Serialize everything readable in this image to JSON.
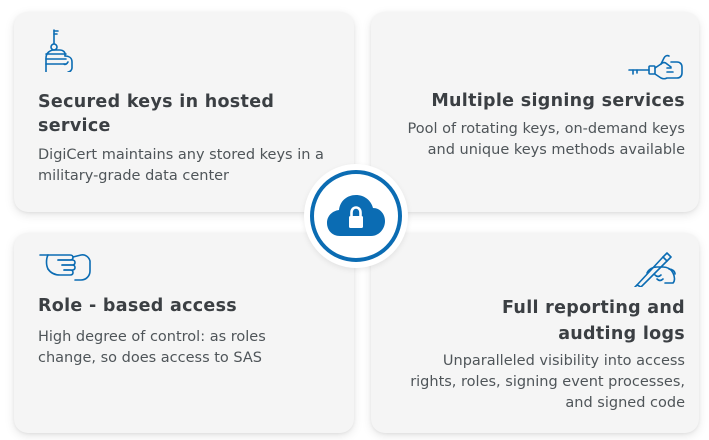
{
  "accent_color": "#0b6cb3",
  "cards": [
    {
      "icon": "hand-holding-key-icon",
      "title": "Secured keys in hosted service",
      "description": "DigiCert maintains any stored keys in a military-grade data center"
    },
    {
      "icon": "hand-offering-key-icon",
      "title": "Multiple signing services",
      "description": "Pool of rotating keys, on-demand keys and unique keys methods available"
    },
    {
      "icon": "pointing-hand-icon",
      "title": "Role - based access",
      "description": "High degree of control: as roles change, so does access to SAS"
    },
    {
      "icon": "hand-writing-icon",
      "title": "Full reporting and audting logs",
      "description": "Unparalleled visibility into access rights, roles, signing event processes, and signed code"
    }
  ],
  "center_icon": "cloud-lock-icon"
}
